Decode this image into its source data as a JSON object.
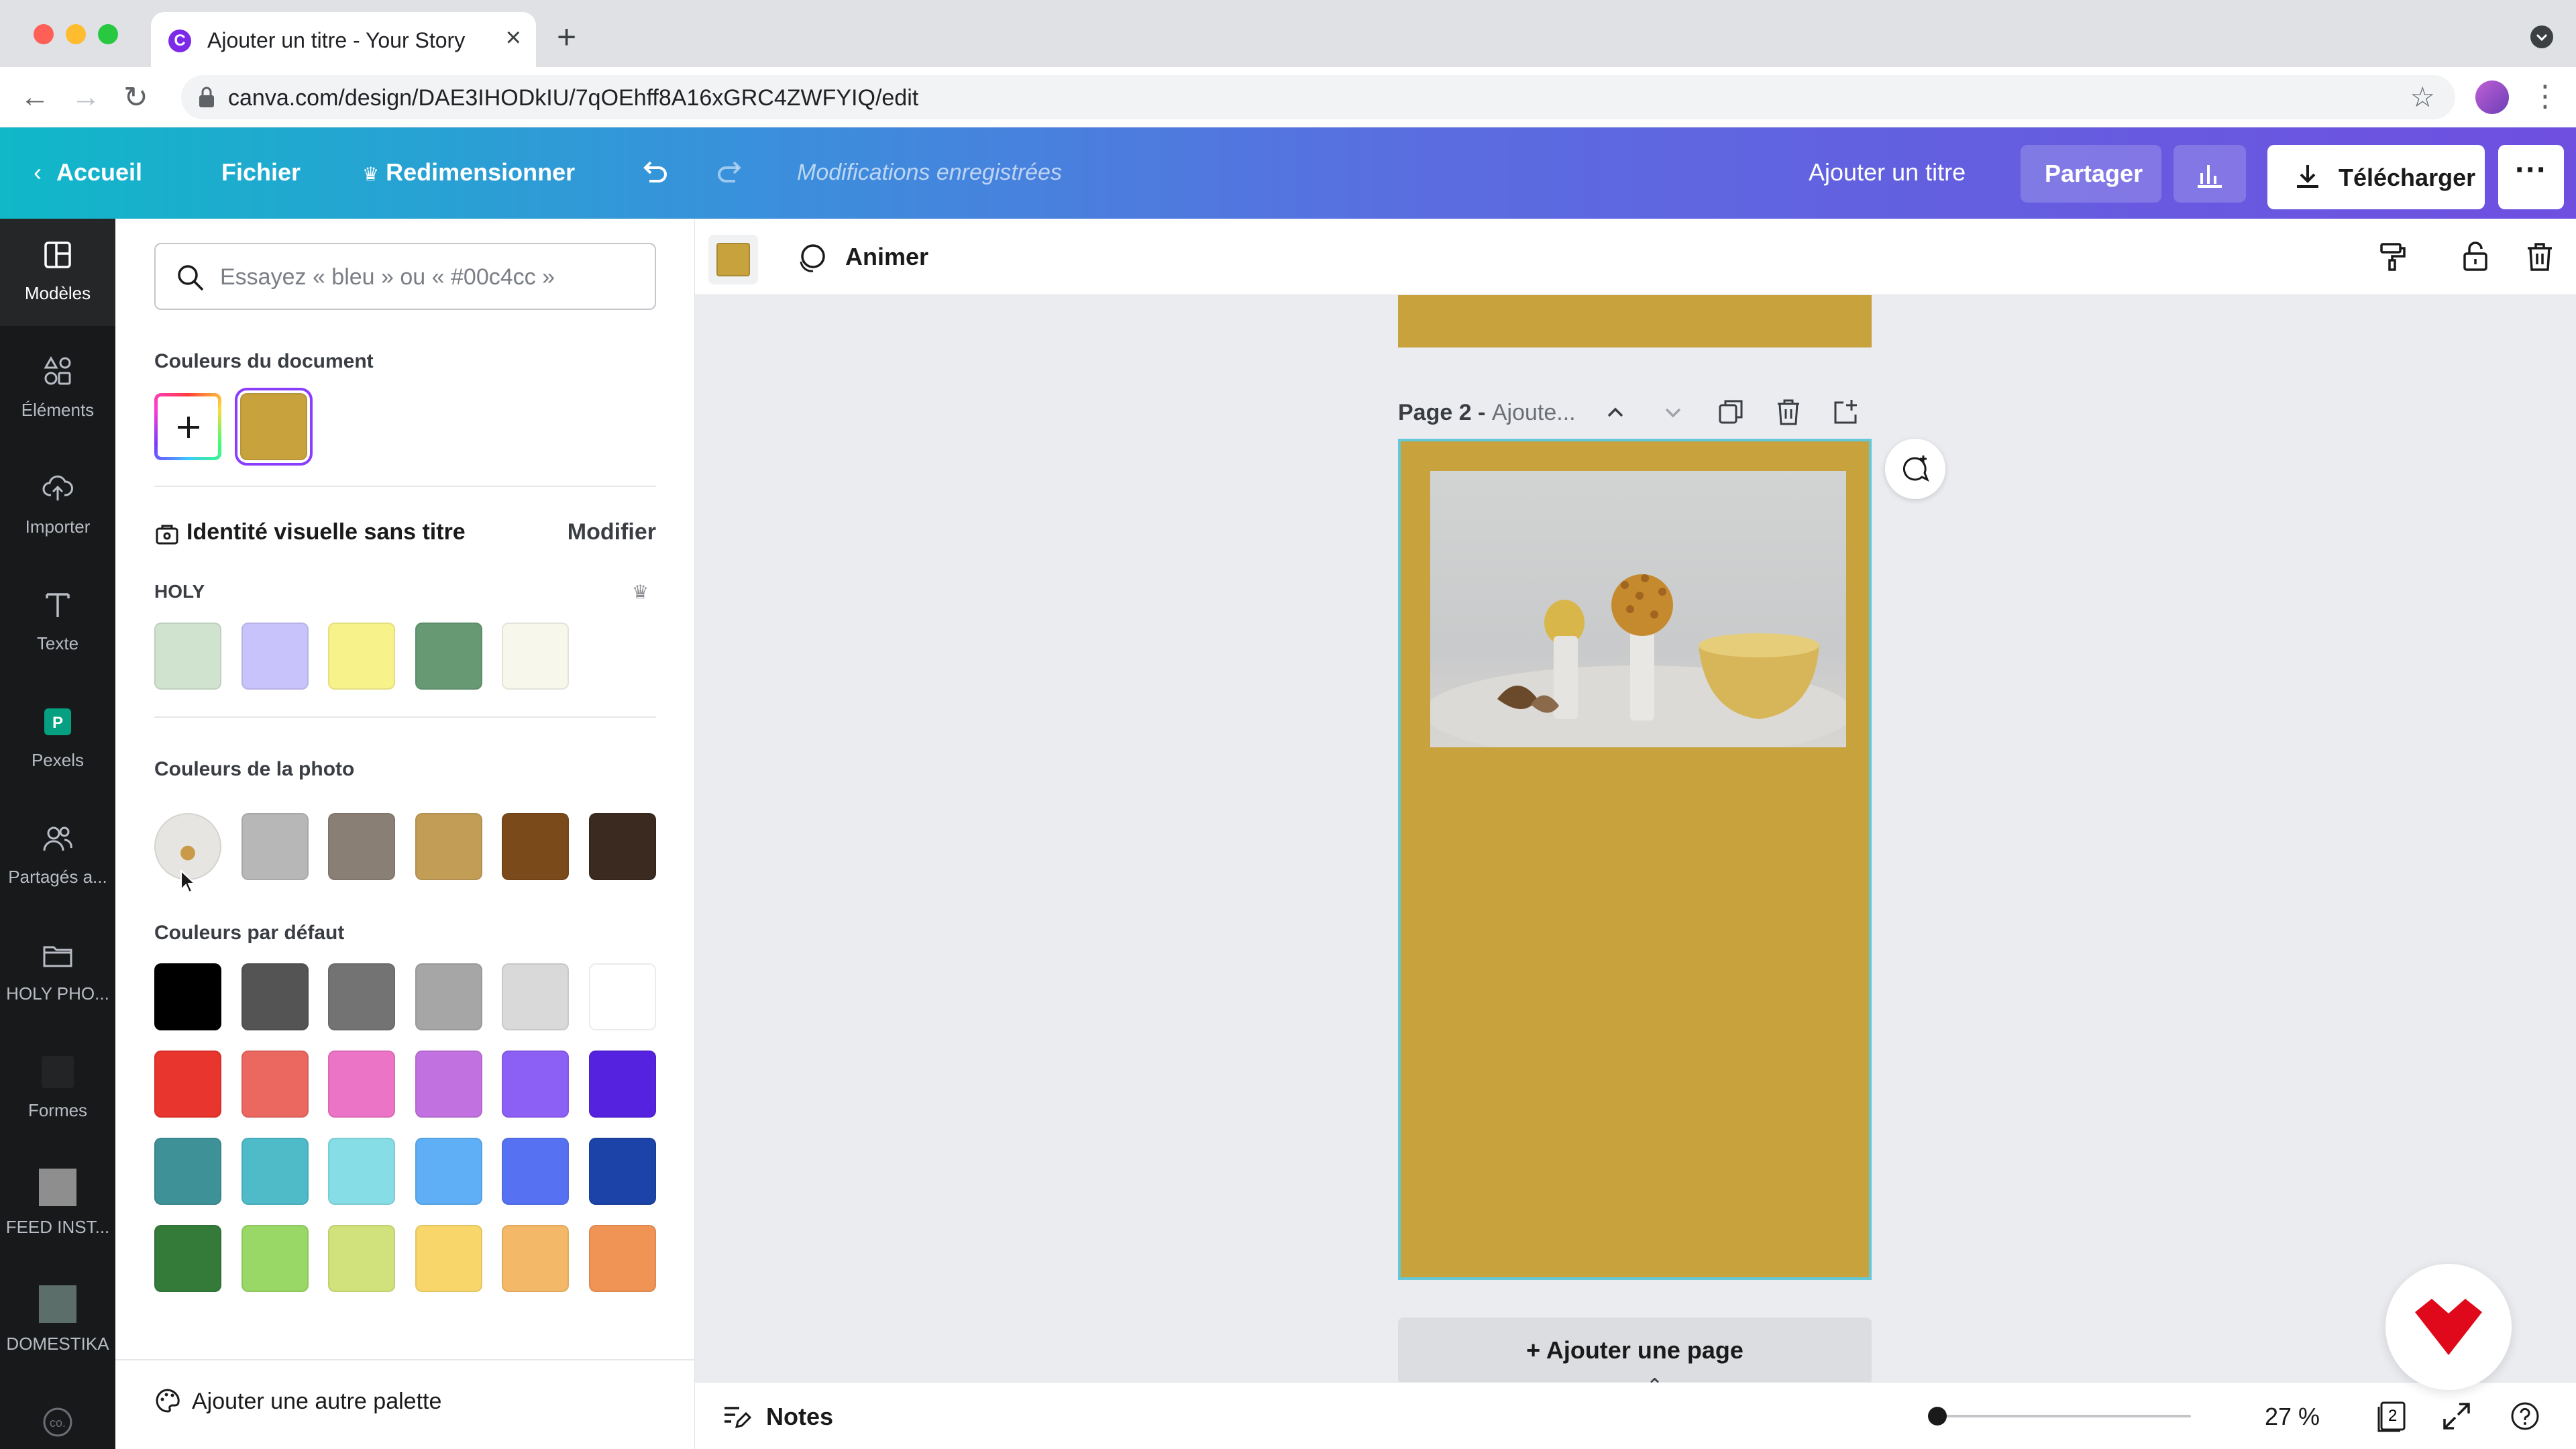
{
  "browser": {
    "tab_title": "Ajouter un titre - Your Story",
    "url": "canva.com/design/DAE3IHODkIU/7qOEhff8A16xGRC4ZWFYIQ/edit"
  },
  "header": {
    "home": "Accueil",
    "file": "Fichier",
    "resize": "Redimensionner",
    "saved_status": "Modifications enregistrées",
    "add_title": "Ajouter un titre",
    "share": "Partager",
    "download": "Télécharger"
  },
  "rail": {
    "items": [
      {
        "label": "Modèles",
        "icon": "templates-icon"
      },
      {
        "label": "Éléments",
        "icon": "elements-icon"
      },
      {
        "label": "Importer",
        "icon": "upload-icon"
      },
      {
        "label": "Texte",
        "icon": "text-icon"
      },
      {
        "label": "Pexels",
        "icon": "pexels-icon"
      },
      {
        "label": "Partagés a...",
        "icon": "shared-icon"
      },
      {
        "label": "HOLY PHO...",
        "icon": "folder-icon"
      },
      {
        "label": "Formes",
        "icon": "shapes-icon"
      },
      {
        "label": "FEED INST...",
        "icon": "feed-thumbnail-icon"
      },
      {
        "label": "DOMESTIKA",
        "icon": "domestika-thumbnail-icon"
      }
    ]
  },
  "panel": {
    "search_placeholder": "Essayez « bleu » ou « #00c4cc »",
    "document_colors_title": "Couleurs du document",
    "document_colors": [
      "#c7a23d"
    ],
    "brand_title": "Identité visuelle sans titre",
    "brand_edit": "Modifier",
    "palette_name": "HOLY",
    "palette_colors": [
      "#cfe3cf",
      "#c8c3fb",
      "#f8f28a",
      "#679a73",
      "#f7f7ec"
    ],
    "photo_colors_title": "Couleurs de la photo",
    "photo_colors": [
      "#b7b7b7",
      "#8a7f74",
      "#c29d56",
      "#7b4a1b",
      "#3a2a20"
    ],
    "default_colors_title": "Couleurs par défaut",
    "default_colors": [
      "#000000",
      "#545454",
      "#737373",
      "#a6a6a6",
      "#d9d9d9",
      "#ffffff",
      "#e8352d",
      "#ea6860",
      "#ec74c7",
      "#c272e0",
      "#8c5ff5",
      "#5523e0",
      "#3f9198",
      "#4fbac8",
      "#86dde5",
      "#5eaff5",
      "#5672f2",
      "#1c44a8",
      "#347b3a",
      "#99d766",
      "#d1e17b",
      "#f8d66a",
      "#f4b869",
      "#f09456"
    ],
    "add_palette": "Ajouter une autre palette"
  },
  "toolbar": {
    "selected_color": "#c7a23d",
    "animate": "Animer"
  },
  "canvas": {
    "page_label": "Page 2 -",
    "page_title_placeholder": "Ajoute...",
    "page_background": "#c7a23d",
    "add_page": "+ Ajouter une page"
  },
  "bottom": {
    "notes": "Notes",
    "zoom": "27 %",
    "zoom_fraction": 0.03,
    "page_count": "2"
  }
}
